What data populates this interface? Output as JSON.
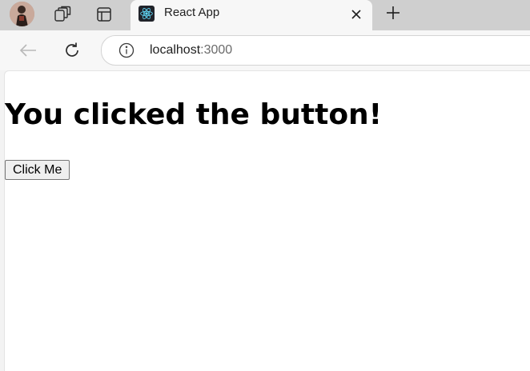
{
  "browser": {
    "tab": {
      "title": "React App",
      "favicon": "react-logo-icon"
    },
    "address_bar": {
      "host": "localhost",
      "port": ":3000"
    },
    "icons": {
      "avatar": "profile-avatar",
      "workspaces": "workspaces-icon",
      "tab_actions": "tab-actions-icon",
      "close": "close-icon",
      "new_tab": "plus-icon",
      "back": "back-arrow-icon",
      "refresh": "refresh-icon",
      "site_info": "info-icon"
    }
  },
  "page": {
    "heading": "You clicked the button!",
    "button_label": "Click Me"
  },
  "colors": {
    "tabstrip": "#cfcfcf",
    "toolbar": "#f7f7f7",
    "react_logo": "#61dafb"
  }
}
